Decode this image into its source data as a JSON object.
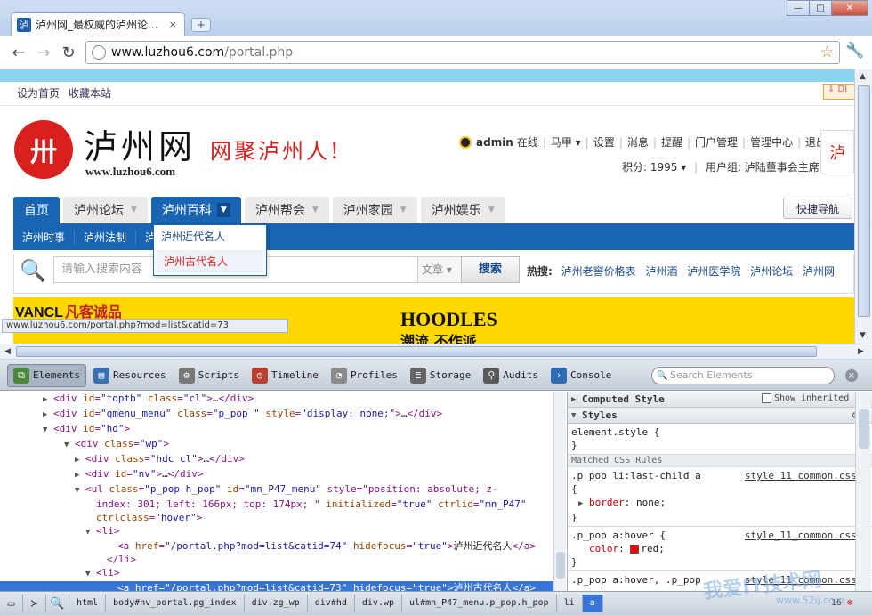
{
  "browser": {
    "tab_title": "泸州网_最权威的泸州论...",
    "tab_close": "×",
    "new_tab": "+",
    "url_host": "www.luzhou6.com",
    "url_path": "/portal.php",
    "win_min": "—",
    "win_max": "□",
    "win_close": "✕"
  },
  "site": {
    "top_links": [
      "设为首页",
      "收藏本站"
    ],
    "top_right_button": "⇓ DI",
    "logo_text": "泸州网",
    "logo_url": "www.luzhou6.com",
    "slogan": "网聚泸州人!",
    "user": {
      "name": "admin",
      "status": "在线",
      "links": [
        "马甲 ▾",
        "设置",
        "消息",
        "提醒",
        "门户管理",
        "管理中心",
        "退出"
      ],
      "points": "积分: 1995 ▾",
      "group": "用户组: 泸陆董事会主席"
    },
    "side_logo": "泸",
    "nav": [
      {
        "label": "首页"
      },
      {
        "label": "泸州论坛"
      },
      {
        "label": "泸州百科"
      },
      {
        "label": "泸州帮会"
      },
      {
        "label": "泸州家园"
      },
      {
        "label": "泸州娱乐"
      }
    ],
    "quick_nav": "快捷导航",
    "subnav": [
      "泸州时事",
      "泸州法制",
      "泸"
    ],
    "dropdown": [
      "泸州近代名人",
      "泸州古代名人"
    ],
    "search": {
      "placeholder": "请输入搜索内容",
      "type": "文章 ▾",
      "button": "搜索",
      "hot_label": "热搜:",
      "hot_words": [
        "泸州老窖价格表",
        "泸州酒",
        "泸州医学院",
        "泸州论坛",
        "泸州网"
      ]
    },
    "banner": {
      "brand": "VANCL",
      "brand_cn": "凡客诚品",
      "headline": "HOODLES",
      "sub": "潮流 不作派"
    },
    "status_url": "www.luzhou6.com/portal.php?mod=list&catid=73"
  },
  "devtools": {
    "tabs": [
      "Elements",
      "Resources",
      "Scripts",
      "Timeline",
      "Profiles",
      "Storage",
      "Audits",
      "Console"
    ],
    "search_placeholder": "Search Elements",
    "dom": [
      {
        "indent": 4,
        "tri": "▶",
        "html": "<div id=\"toptb\" class=\"cl\">…</div>"
      },
      {
        "indent": 4,
        "tri": "▶",
        "html": "<div id=\"qmenu_menu\" class=\"p_pop \" style=\"display: none;\">…</div>"
      },
      {
        "indent": 4,
        "tri": "▼",
        "html": "<div id=\"hd\">"
      },
      {
        "indent": 6,
        "tri": "▼",
        "html": "<div class=\"wp\">"
      },
      {
        "indent": 7,
        "tri": "▶",
        "html": "<div class=\"hdc cl\">…</div>"
      },
      {
        "indent": 7,
        "tri": "▶",
        "html": "<div id=\"nv\">…</div>"
      },
      {
        "indent": 7,
        "tri": "▼",
        "html": "<ul class=\"p_pop h_pop\" id=\"mn_P47_menu\" style=\"position: absolute; z-"
      },
      {
        "indent": 8,
        "tri": "",
        "html": "index: 301; left: 166px; top: 174px; \" initialized=\"true\" ctrlid=\"mn_P47\""
      },
      {
        "indent": 8,
        "tri": "",
        "html": "ctrlclass=\"hover\">"
      },
      {
        "indent": 8,
        "tri": "▼",
        "html": "<li>"
      },
      {
        "indent": 10,
        "tri": "",
        "html": "<a href=\"/portal.php?mod=list&catid=74\" hidefocus=\"true\">泸州近代名人</a>"
      },
      {
        "indent": 9,
        "tri": "",
        "html": "</li>"
      },
      {
        "indent": 8,
        "tri": "▼",
        "html": "<li>"
      },
      {
        "indent": 10,
        "tri": "",
        "html": "<a href=\"/portal.php?mod=list&catid=73\" hidefocus=\"true\">泸州古代名人</a>",
        "selected": true
      },
      {
        "indent": 9,
        "tri": "",
        "html": "</li>"
      },
      {
        "indent": 8,
        "tri": "",
        "html": "</ul>"
      }
    ],
    "sidebar": {
      "computed": "Computed Style",
      "show_inherited": "Show inherited",
      "styles": "Styles",
      "element_style": "element.style {",
      "close_brace": "}",
      "matched": "Matched CSS Rules",
      "rules": [
        {
          "selector": ".p_pop li:last-child a",
          "source": "style_11_common.css:1",
          "brace": "{",
          "prop": "border",
          "value": "none;"
        },
        {
          "selector": ".p_pop a:hover {",
          "source": "style_11_common.css:1",
          "brace": "",
          "prop": "color",
          "value": "red;"
        },
        {
          "selector": ".p_pop a:hover, .p_pop",
          "source": "style_11_common.css:1",
          "brace": "",
          "prop": "",
          "value": ""
        }
      ]
    },
    "breadcrumbs": [
      "html",
      "body#nv_portal.pg_index",
      "div.zg_wp",
      "div#hd",
      "div.wp",
      "ul#mn_P47_menu.p_pop.h_pop",
      "li",
      "a"
    ],
    "error_count": "16"
  },
  "watermark": {
    "text": "我爱IT技术网",
    "sub": "www.52ij.com"
  }
}
